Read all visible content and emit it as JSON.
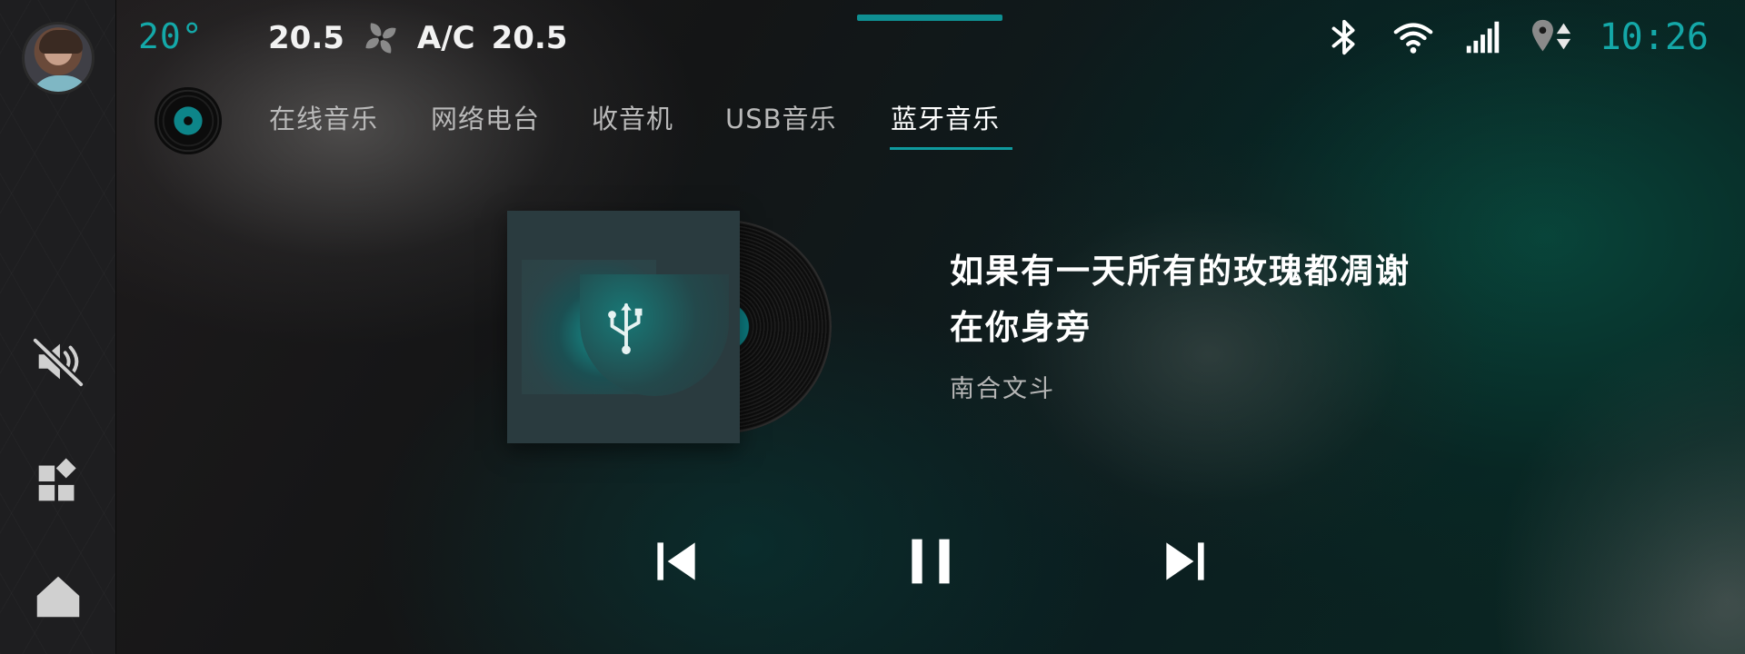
{
  "status": {
    "outside_temp": "20°",
    "climate_left": "20.5",
    "ac_label": "A/C",
    "climate_right": "20.5",
    "time": "10:26"
  },
  "tabs": [
    {
      "label": "在线音乐",
      "active": false
    },
    {
      "label": "网络电台",
      "active": false
    },
    {
      "label": "收音机",
      "active": false
    },
    {
      "label": "USB音乐",
      "active": false
    },
    {
      "label": "蓝牙音乐",
      "active": true
    }
  ],
  "track": {
    "title": "如果有一天所有的玫瑰都凋谢在你身旁",
    "artist": "南合文斗"
  },
  "playback": {
    "state": "playing"
  },
  "sidebar": {
    "icons": [
      "mute-icon",
      "apps-icon",
      "home-icon"
    ]
  },
  "theme": {
    "accent": "#14a8a8"
  }
}
